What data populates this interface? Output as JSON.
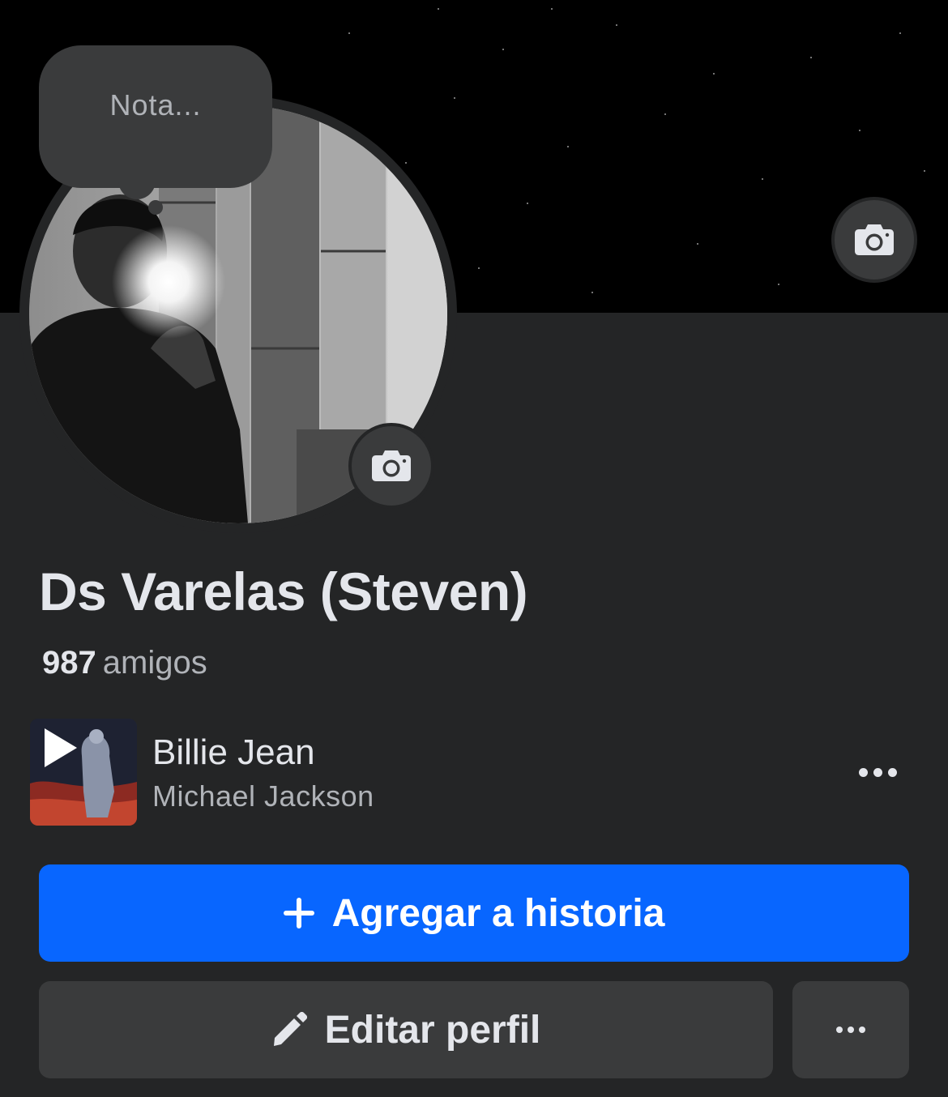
{
  "note": {
    "placeholder": "Nota..."
  },
  "profile": {
    "name": "Ds Varelas (Steven)",
    "friends_count": "987",
    "friends_label": "amigos"
  },
  "music": {
    "title": "Billie Jean",
    "artist": "Michael Jackson"
  },
  "actions": {
    "add_story_label": "Agregar a historia",
    "edit_profile_label": "Editar perfil"
  },
  "icons": {
    "cover_camera": "camera-icon",
    "avatar_camera": "camera-icon",
    "play": "play-icon",
    "more": "more-horizontal-icon",
    "plus": "plus-icon",
    "pencil": "pencil-icon"
  },
  "colors": {
    "background": "#242526",
    "primary_button": "#0866ff",
    "secondary_button": "#3a3b3c"
  }
}
